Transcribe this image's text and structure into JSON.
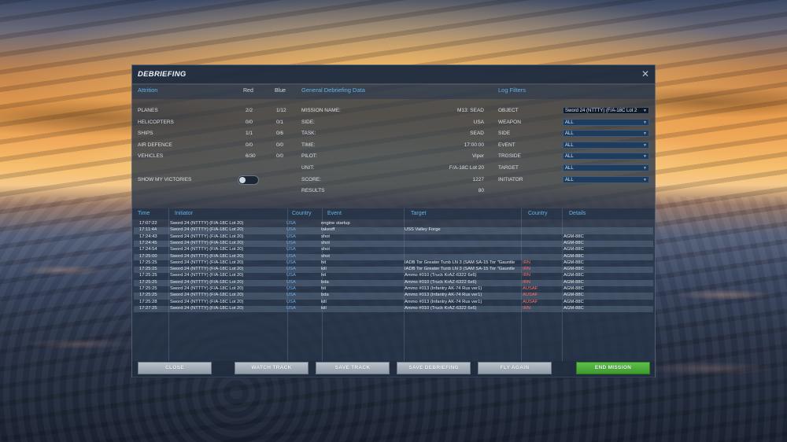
{
  "window": {
    "title": "DEBRIEFING"
  },
  "colors": {
    "accent": "#5fb0e6",
    "usa": "#6aa9e8",
    "red_side": "#ff6a5c",
    "end_mission": "#4caf3a"
  },
  "attrition": {
    "header": "Attrition",
    "col_red": "Red",
    "col_blue": "Blue",
    "rows": [
      {
        "label": "PLANES",
        "red": "2/2",
        "blue": "1/12"
      },
      {
        "label": "HELICOPTERS",
        "red": "0/0",
        "blue": "0/1"
      },
      {
        "label": "SHIPS",
        "red": "1/1",
        "blue": "0/6"
      },
      {
        "label": "AIR DEFENCE",
        "red": "0/0",
        "blue": "0/0"
      },
      {
        "label": "VEHICLES",
        "red": "6/30",
        "blue": "0/0"
      }
    ],
    "show_victories_label": "SHOW MY VICTORIES",
    "show_victories_on": false
  },
  "general": {
    "header": "General Debriefing Data",
    "rows": [
      {
        "label": "MISSION NAME:",
        "value": "M13: SEAD"
      },
      {
        "label": "SIDE:",
        "value": "USA"
      },
      {
        "label": "TASK:",
        "value": "SEAD"
      },
      {
        "label": "TIME:",
        "value": "17:00:00"
      },
      {
        "label": "PILOT:",
        "value": "Viper"
      },
      {
        "label": "UNIT:",
        "value": "F/A-18C Lot 20"
      },
      {
        "label": "SCORE:",
        "value": "1227"
      },
      {
        "label": "RESULTS",
        "value": "80"
      }
    ]
  },
  "filters": {
    "header": "Log Filters",
    "rows": [
      {
        "label": "OBJECT",
        "value": "Sword 24 (NTTTY) (F/A-18C Lot 2"
      },
      {
        "label": "WEAPON",
        "value": "ALL"
      },
      {
        "label": "SIDE",
        "value": "ALL"
      },
      {
        "label": "EVENT",
        "value": "ALL"
      },
      {
        "label": "TRGSIDE",
        "value": "ALL"
      },
      {
        "label": "TARGET",
        "value": "ALL"
      },
      {
        "label": "INITIATOR",
        "value": "ALL"
      }
    ]
  },
  "log": {
    "columns": {
      "time": "Time",
      "initiator": "Initiator",
      "country": "Country",
      "event": "Event",
      "target": "Target",
      "tcountry": "Country",
      "details": "Details"
    },
    "rows": [
      {
        "time": "17:07:22",
        "initiator": "Sword 24 (NTTTY) (F/A-18C Lot 20)",
        "country": "USA",
        "event": "engine startup",
        "target": "",
        "tcountry": "",
        "details": ""
      },
      {
        "time": "17:11:44",
        "initiator": "Sword 24 (NTTTY) (F/A-18C Lot 20)",
        "country": "USA",
        "event": "takeoff",
        "target": "USS Valley Forge",
        "tcountry": "",
        "details": ""
      },
      {
        "time": "17:24:43",
        "initiator": "Sword 24 (NTTTY) (F/A-18C Lot 20)",
        "country": "USA",
        "event": "shot",
        "target": "",
        "tcountry": "",
        "details": "AGM-88C"
      },
      {
        "time": "17:24:45",
        "initiator": "Sword 24 (NTTTY) (F/A-18C Lot 20)",
        "country": "USA",
        "event": "shot",
        "target": "",
        "tcountry": "",
        "details": "AGM-88C"
      },
      {
        "time": "17:24:54",
        "initiator": "Sword 24 (NTTTY) (F/A-18C Lot 20)",
        "country": "USA",
        "event": "shot",
        "target": "",
        "tcountry": "",
        "details": "AGM-88C"
      },
      {
        "time": "17:25:00",
        "initiator": "Sword 24 (NTTTY) (F/A-18C Lot 20)",
        "country": "USA",
        "event": "shot",
        "target": "",
        "tcountry": "",
        "details": "AGM-88C"
      },
      {
        "time": "17:25:25",
        "initiator": "Sword 24 (NTTTY) (F/A-18C Lot 20)",
        "country": "USA",
        "event": "hit",
        "target": "IADB Tor Greater Tunb LN 3 (SAM SA-15 Tor \"Gauntle",
        "tcountry": "IRN",
        "details": "AGM-88C"
      },
      {
        "time": "17:25:25",
        "initiator": "Sword 24 (NTTTY) (F/A-18C Lot 20)",
        "country": "USA",
        "event": "kill",
        "target": "IADB Tor Greater Tunb LN 3 (SAM SA-15 Tor \"Gauntle",
        "tcountry": "IRN",
        "details": "AGM-88C"
      },
      {
        "time": "17:25:25",
        "initiator": "Sword 24 (NTTTY) (F/A-18C Lot 20)",
        "country": "USA",
        "event": "hit",
        "target": "Ammo #010 (Truck KrAZ-6322 6x6)",
        "tcountry": "IRN",
        "details": "AGM-88C"
      },
      {
        "time": "17:25:25",
        "initiator": "Sword 24 (NTTTY) (F/A-18C Lot 20)",
        "country": "USA",
        "event": "bda",
        "target": "Ammo #010 (Truck KrAZ-6322 6x6)",
        "tcountry": "IRN",
        "details": "AGM-88C"
      },
      {
        "time": "17:25:25",
        "initiator": "Sword 24 (NTTTY) (F/A-18C Lot 20)",
        "country": "USA",
        "event": "hit",
        "target": "Ammo #013 (Infantry AK-74 Rus ver1)",
        "tcountry": "AUSAF",
        "details": "AGM-88C"
      },
      {
        "time": "17:25:25",
        "initiator": "Sword 24 (NTTTY) (F/A-18C Lot 20)",
        "country": "USA",
        "event": "bda",
        "target": "Ammo #013 (Infantry AK-74 Rus ver1)",
        "tcountry": "AUSAF",
        "details": "AGM-88C"
      },
      {
        "time": "17:25:28",
        "initiator": "Sword 24 (NTTTY) (F/A-18C Lot 20)",
        "country": "USA",
        "event": "kill",
        "target": "Ammo #013 (Infantry AK-74 Rus ver1)",
        "tcountry": "AUSAF",
        "details": "AGM-88C"
      },
      {
        "time": "17:27:25",
        "initiator": "Sword 24 (NTTTY) (F/A-18C Lot 20)",
        "country": "USA",
        "event": "kill",
        "target": "Ammo #010 (Truck KrAZ-6322 6x6)",
        "tcountry": "IRN",
        "details": "AGM-88C"
      }
    ]
  },
  "buttons": {
    "close": "CLOSE",
    "watch_track": "WATCH TRACK",
    "save_track": "SAVE TRACK",
    "save_debriefing": "SAVE DEBRIEFING",
    "fly_again": "FLY AGAIN",
    "end_mission": "END MISSION"
  }
}
